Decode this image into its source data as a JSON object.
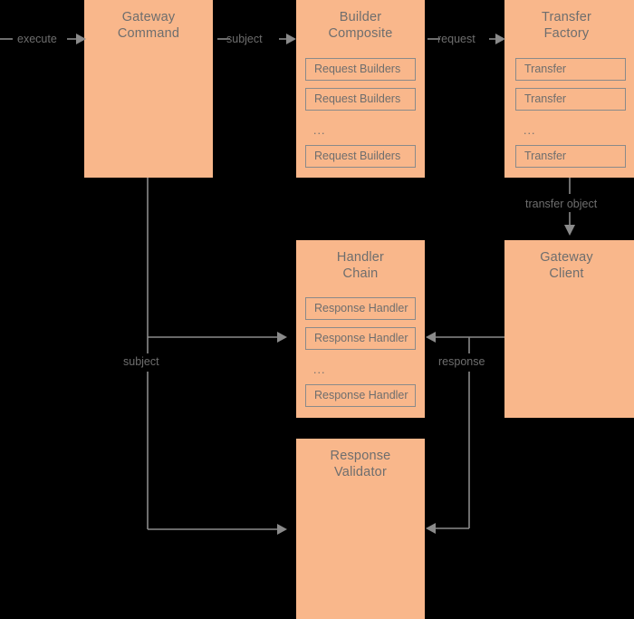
{
  "diagram": {
    "background_color": "#000000",
    "node_fill": "#f9b78b",
    "line_color": "#8a8a8a",
    "text_color": "#6e6e6e",
    "nodes": [
      {
        "id": "gateway-command",
        "title": "Gateway\nCommand",
        "items": []
      },
      {
        "id": "builder-composite",
        "title": "Builder\nComposite",
        "items": [
          "Request Builders",
          "Request Builders",
          "Request Builders"
        ],
        "ellipsis": "..."
      },
      {
        "id": "transfer-factory",
        "title": "Transfer\nFactory",
        "items": [
          "Transfer",
          "Transfer",
          "Transfer"
        ],
        "ellipsis": "..."
      },
      {
        "id": "handler-chain",
        "title": "Handler\nChain",
        "items": [
          "Response Handler",
          "Response Handler",
          "Response Handler"
        ],
        "ellipsis": "..."
      },
      {
        "id": "gateway-client",
        "title": "Gateway\nClient",
        "items": []
      },
      {
        "id": "response-validator",
        "title": "Response\nValidator",
        "items": []
      }
    ],
    "edges": [
      {
        "id": "execute",
        "label": "execute",
        "from": "external",
        "to": "gateway-command"
      },
      {
        "id": "subject-top",
        "label": "subject",
        "from": "gateway-command",
        "to": "builder-composite"
      },
      {
        "id": "request",
        "label": "request",
        "from": "builder-composite",
        "to": "transfer-factory"
      },
      {
        "id": "transfer-object",
        "label": "transfer object",
        "from": "transfer-factory",
        "to": "gateway-client"
      },
      {
        "id": "subject-left",
        "label": "subject",
        "from": "gateway-command",
        "to": "handler-chain"
      },
      {
        "id": "response",
        "label": "response",
        "from": "gateway-client",
        "to": "handler-chain"
      }
    ]
  }
}
